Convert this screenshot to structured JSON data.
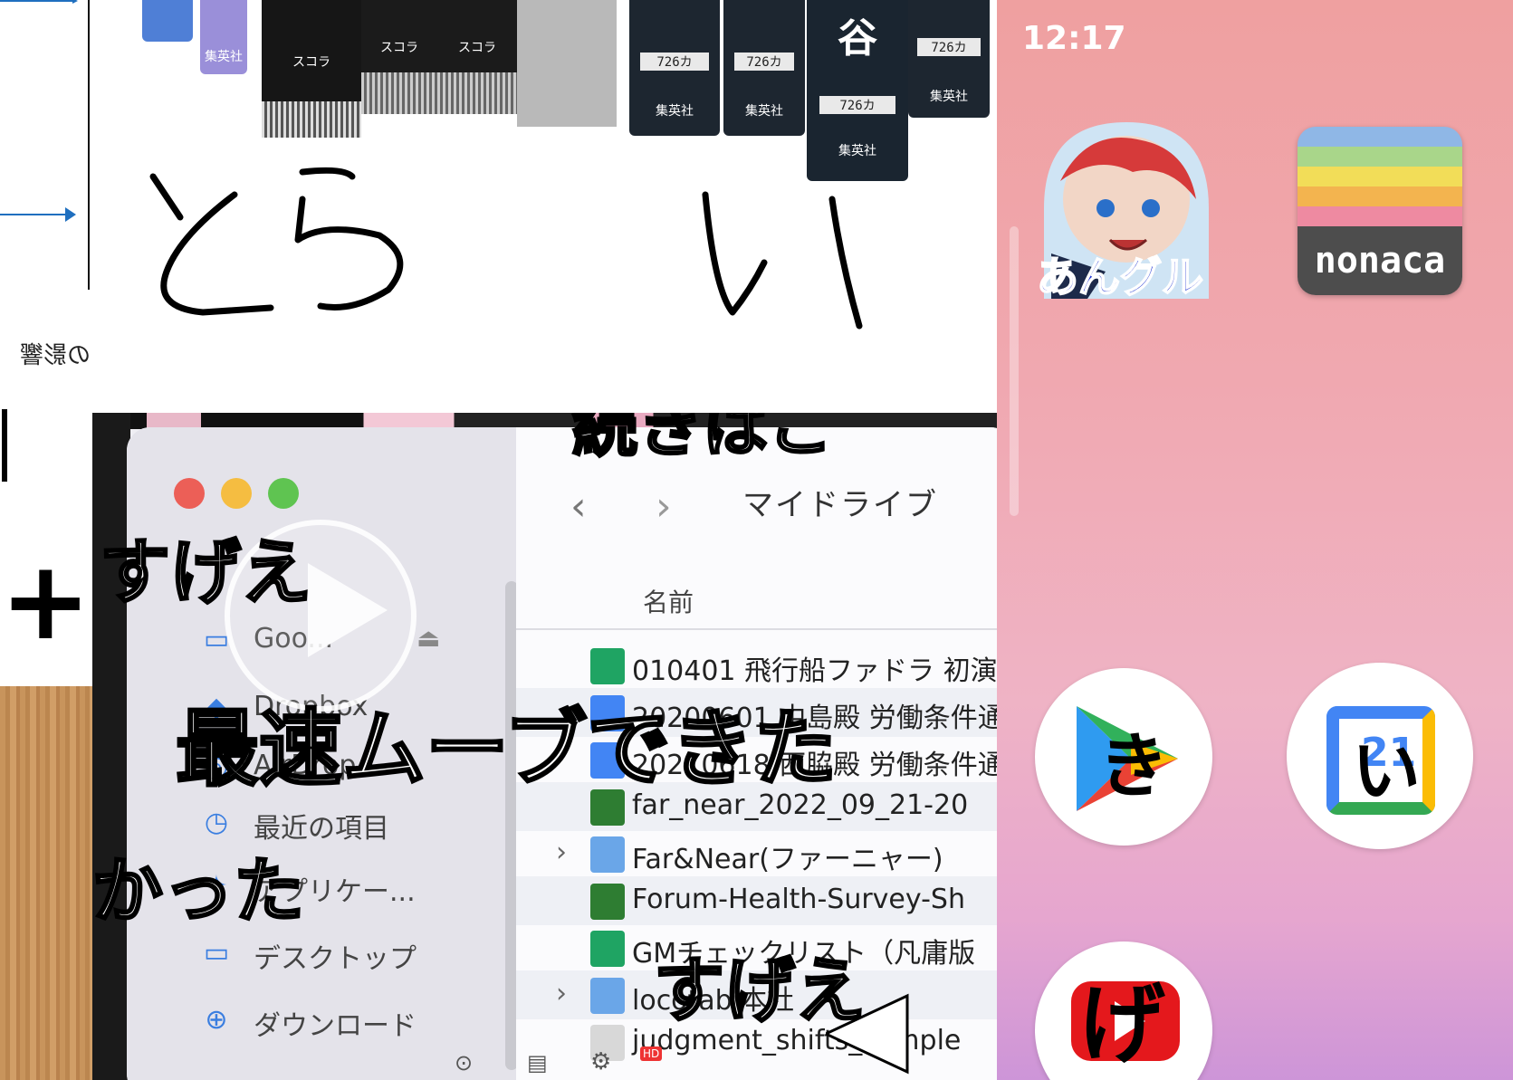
{
  "left_strip": {
    "mirrored_text": "の影響"
  },
  "top_panel": {
    "book_labels": [
      "集英社",
      "スコラ",
      "スコラ",
      "スコラ",
      "726カ",
      "726カ",
      "726カ",
      "726カ",
      "集英社",
      "集英社",
      "集英社",
      "集英社"
    ],
    "book_title_char": "谷",
    "handwriting_left": "とら",
    "handwriting_right": "い"
  },
  "video": {
    "finder": {
      "back_symbol": "‹",
      "forward_symbol": "›",
      "drive_title": "マイドライブ",
      "column_header": "名前",
      "sidebar": [
        {
          "icon": "folder-cloud-icon",
          "label": "Goo..."
        },
        {
          "icon": "dropbox-icon",
          "label": "Dropbox"
        },
        {
          "icon": "airdrop-icon",
          "label": "AirDrop"
        },
        {
          "icon": "clock-icon",
          "label": "最近の項目"
        },
        {
          "icon": "apps-icon",
          "label": "アプリケー..."
        },
        {
          "icon": "desktop-icon",
          "label": "デスクトップ"
        },
        {
          "icon": "download-icon",
          "label": "ダウンロード"
        }
      ],
      "files": [
        {
          "icon": "sheets-icon",
          "name": "010401 飛行船ファドラ 初演",
          "expand": false
        },
        {
          "icon": "docs-icon",
          "name": "20200601 中島殿 労働条件通",
          "expand": false
        },
        {
          "icon": "docs-icon",
          "name": "20210618 西脇殿 労働条件通",
          "expand": false
        },
        {
          "icon": "excel-icon",
          "name": "far_near_2022_09_21-20",
          "expand": false
        },
        {
          "icon": "folder-icon",
          "name": "Far&Near(ファーニャー)",
          "expand": true
        },
        {
          "icon": "excel-icon",
          "name": "Forum-Health-Survey-Sh",
          "expand": false
        },
        {
          "icon": "sheets-icon",
          "name": "GMチェックリスト（凡庸版",
          "expand": false
        },
        {
          "icon": "folder-icon",
          "name": "locotabi本社",
          "expand": true
        },
        {
          "icon": "file-icon",
          "name": "judgment_shifts_sample",
          "expand": false
        }
      ]
    },
    "captions": {
      "top": "続きはこ",
      "sugee_1": "すげえ",
      "main": "最速ムーブできた",
      "katta": "かった",
      "sugee_2": "すげえ"
    },
    "hd_badge": "HD"
  },
  "phone": {
    "time": "12:17",
    "apps": [
      {
        "name": "anguru-app",
        "label_overlay": "あんグル"
      },
      {
        "name": "nonaca-app",
        "label_overlay": "nonaca"
      },
      {
        "name": "play-store-app",
        "label_overlay": "き"
      },
      {
        "name": "calendar-app",
        "label_overlay": "い",
        "day": "21"
      },
      {
        "name": "youtube-app",
        "label_overlay": "げ"
      }
    ]
  },
  "colors": {
    "arrow_blue": "#1f6fbf",
    "traffic_red": "#ec5f57",
    "traffic_yellow": "#f5bd41",
    "traffic_green": "#5fc451",
    "folder_blue": "#3a7ee0",
    "sheets_green": "#1fa463",
    "docs_blue": "#4285f4"
  }
}
